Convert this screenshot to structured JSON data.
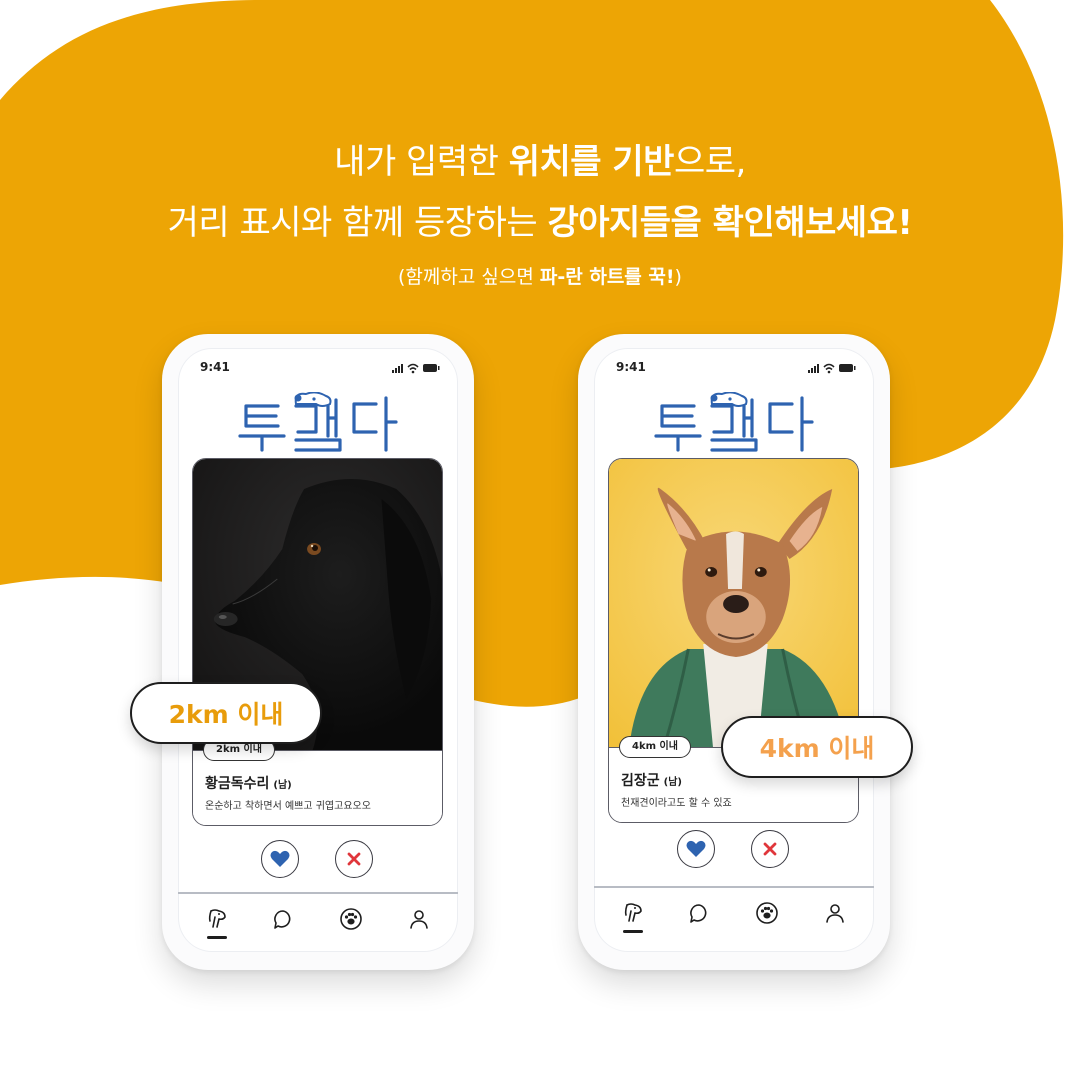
{
  "headline": {
    "line1_a": "내가 입력한 ",
    "line1_b": "위치를 기반",
    "line1_c": "으로,",
    "line2_a": "거리 표시와 함께 등장하는 ",
    "line2_b": "강아지들을 확인해보세요!",
    "line3_a": "(함께하고 싶으면 ",
    "line3_b": "파-란 하트를 꾹!",
    "line3_c": ")"
  },
  "colors": {
    "blob": "#eda505",
    "brand_blue": "#2e63b0",
    "pass_red": "#e0363b",
    "callout_1": "#e89c0b",
    "callout_2": "#f4a14d"
  },
  "phones": [
    {
      "status_time": "9:41",
      "card": {
        "distance_badge": "2km 이내",
        "name": "황금독수리",
        "gender": "(남)",
        "description": "온순하고 착하면서 예쁘고 귀엽고요오오"
      },
      "callout": "2km 이내"
    },
    {
      "status_time": "9:41",
      "card": {
        "distance_badge": "4km 이내",
        "name": "김장군",
        "gender": "(남)",
        "description": "천재견이라고도 할 수 있죠"
      },
      "callout": "4km 이내"
    }
  ],
  "icons": {
    "like": "heart-icon",
    "pass": "close-icon",
    "tabs": [
      "dog-icon",
      "chat-bubble-icon",
      "paw-icon",
      "user-icon"
    ]
  }
}
